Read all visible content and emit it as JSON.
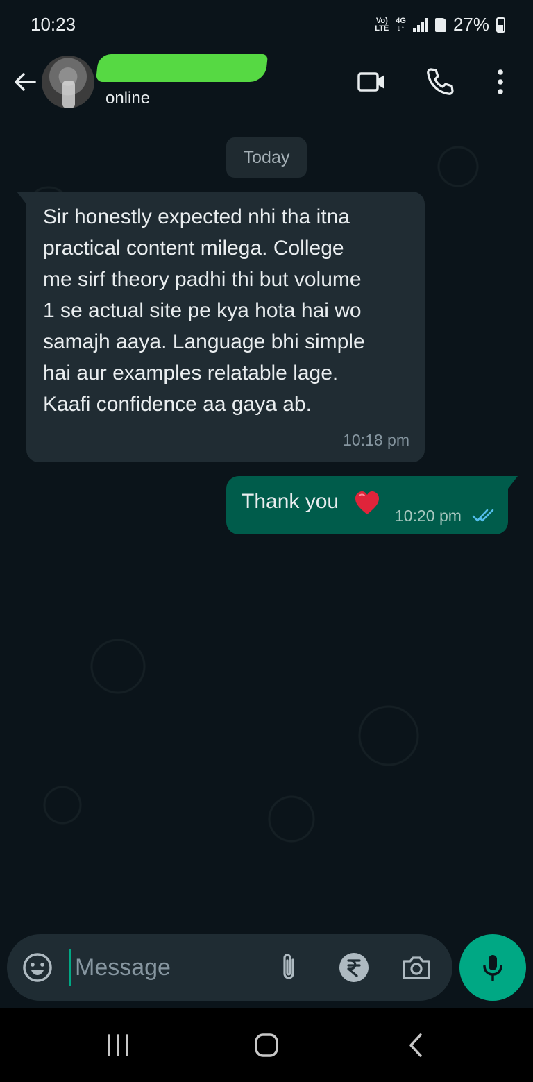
{
  "status_bar": {
    "time": "10:23",
    "network_top": "Vo)",
    "network_bottom": "LTE",
    "data_top": "4G",
    "data_bottom": "↓↑",
    "battery": "27%"
  },
  "header": {
    "contact_status": "online",
    "icons": [
      "back-arrow-icon",
      "video-call-icon",
      "voice-call-icon",
      "more-options-icon"
    ]
  },
  "chat": {
    "day_label": "Today",
    "incoming": {
      "text": "Sir honestly expected nhi tha itna\npractical content milega. College\nme sirf theory padhi thi but volume\n1 se actual site pe kya hota hai wo\nsamajh aaya. Language bhi simple\nhai aur examples relatable lage.\nKaafi confidence aa gaya ab.",
      "time": "10:18 pm"
    },
    "outgoing": {
      "text": "Thank you",
      "emoji": "heart-icon",
      "time": "10:20 pm",
      "status": "read-double-tick-icon"
    }
  },
  "composer": {
    "placeholder": "Message",
    "icons": [
      "emoji-icon",
      "attach-icon",
      "rupee-payment-icon",
      "camera-icon",
      "mic-icon"
    ]
  },
  "colors": {
    "background": "#0b141a",
    "incoming_bubble": "#202c33",
    "outgoing_bubble": "#005c4b",
    "accent": "#00a884",
    "read_tick": "#53bdeb"
  }
}
